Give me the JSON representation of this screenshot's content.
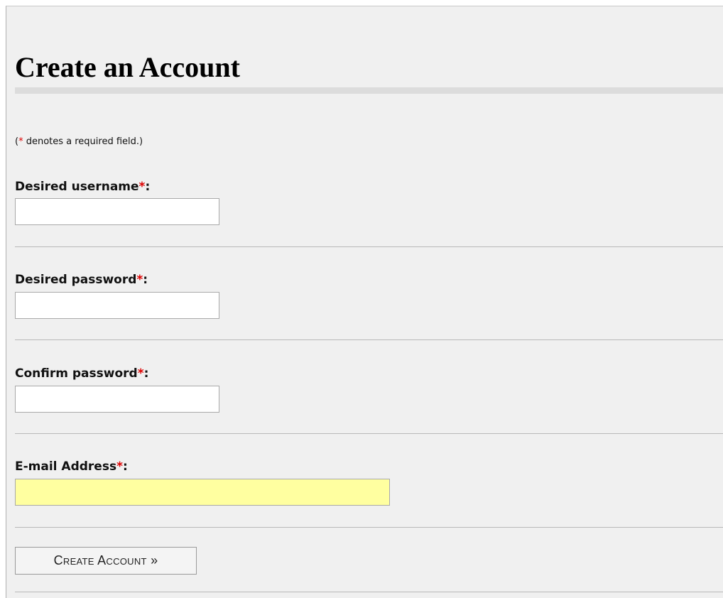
{
  "form": {
    "title": "Create an Account",
    "required_note": {
      "open": "(",
      "asterisk": "*",
      "text": " denotes a required field.)"
    },
    "fields": [
      {
        "label": "Desired username",
        "asterisk": "*",
        "colon": ":",
        "value": ""
      },
      {
        "label": "Desired password",
        "asterisk": "*",
        "colon": ":",
        "value": ""
      },
      {
        "label": "Confirm password",
        "asterisk": "*",
        "colon": ":",
        "value": ""
      },
      {
        "label": "E-mail Address",
        "asterisk": "*",
        "colon": ":",
        "value": ""
      }
    ],
    "submit_label": "Create Account »"
  },
  "colors": {
    "background": "#f0f0f0",
    "required_asterisk": "#dd0000",
    "email_field_highlight": "#ffffa0",
    "title_rule": "#dcdcdc"
  }
}
